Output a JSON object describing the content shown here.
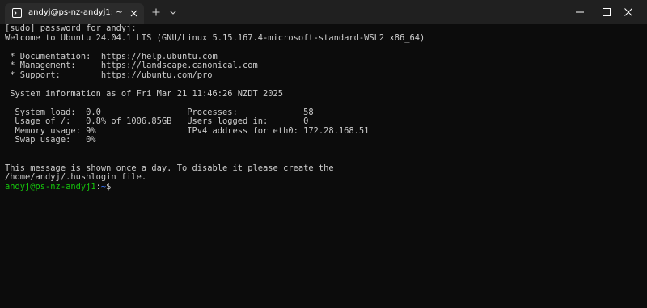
{
  "window": {
    "tab_title": "andyj@ps-nz-andyj1: ~",
    "colors": {
      "background": "#0c0c0c",
      "titlebar": "#202020",
      "tab": "#2b2b2b",
      "text": "#cccccc",
      "prompt_user": "#16c60c",
      "prompt_path": "#3b78ff"
    },
    "icons": {
      "tab_icon": "terminal-icon",
      "tab_close": "close-icon",
      "new_tab": "plus-icon",
      "dropdown": "chevron-down-icon",
      "minimize": "minimize-icon",
      "maximize": "maximize-icon",
      "close": "close-icon"
    }
  },
  "terminal": {
    "lines": [
      "[sudo] password for andyj:",
      "Welcome to Ubuntu 24.04.1 LTS (GNU/Linux 5.15.167.4-microsoft-standard-WSL2 x86_64)",
      "",
      " * Documentation:  https://help.ubuntu.com",
      " * Management:     https://landscape.canonical.com",
      " * Support:        https://ubuntu.com/pro",
      "",
      " System information as of Fri Mar 21 11:46:26 NZDT 2025",
      "",
      "  System load:  0.0                 Processes:             58",
      "  Usage of /:   0.8% of 1006.85GB   Users logged in:       0",
      "  Memory usage: 9%                  IPv4 address for eth0: 172.28.168.51",
      "  Swap usage:   0%",
      "",
      "",
      "This message is shown once a day. To disable it please create the",
      "/home/andyj/.hushlogin file."
    ],
    "prompt": {
      "user_host": "andyj@ps-nz-andyj1",
      "separator": ":",
      "path": "~",
      "symbol": "$"
    }
  }
}
